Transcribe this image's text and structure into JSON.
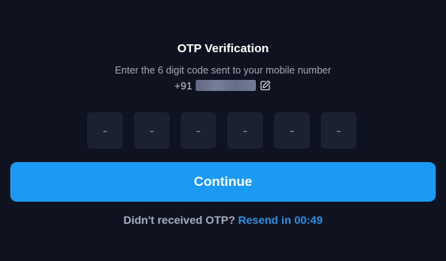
{
  "header": {
    "title": "OTP Verification",
    "subtitle": "Enter the 6 digit code sent to your mobile number"
  },
  "phone": {
    "country_code": "+91"
  },
  "otp": {
    "boxes": [
      "-",
      "-",
      "-",
      "-",
      "-",
      "-"
    ]
  },
  "actions": {
    "continue_label": "Continue"
  },
  "resend": {
    "prefix": "Didn't received OTP?",
    "link_text": "Resend in 00:49"
  },
  "colors": {
    "background": "#0f1320",
    "accent": "#1a9af3",
    "link": "#2d8fe0",
    "otp_box": "#1c2130"
  },
  "icons": {
    "edit": "edit-icon"
  }
}
